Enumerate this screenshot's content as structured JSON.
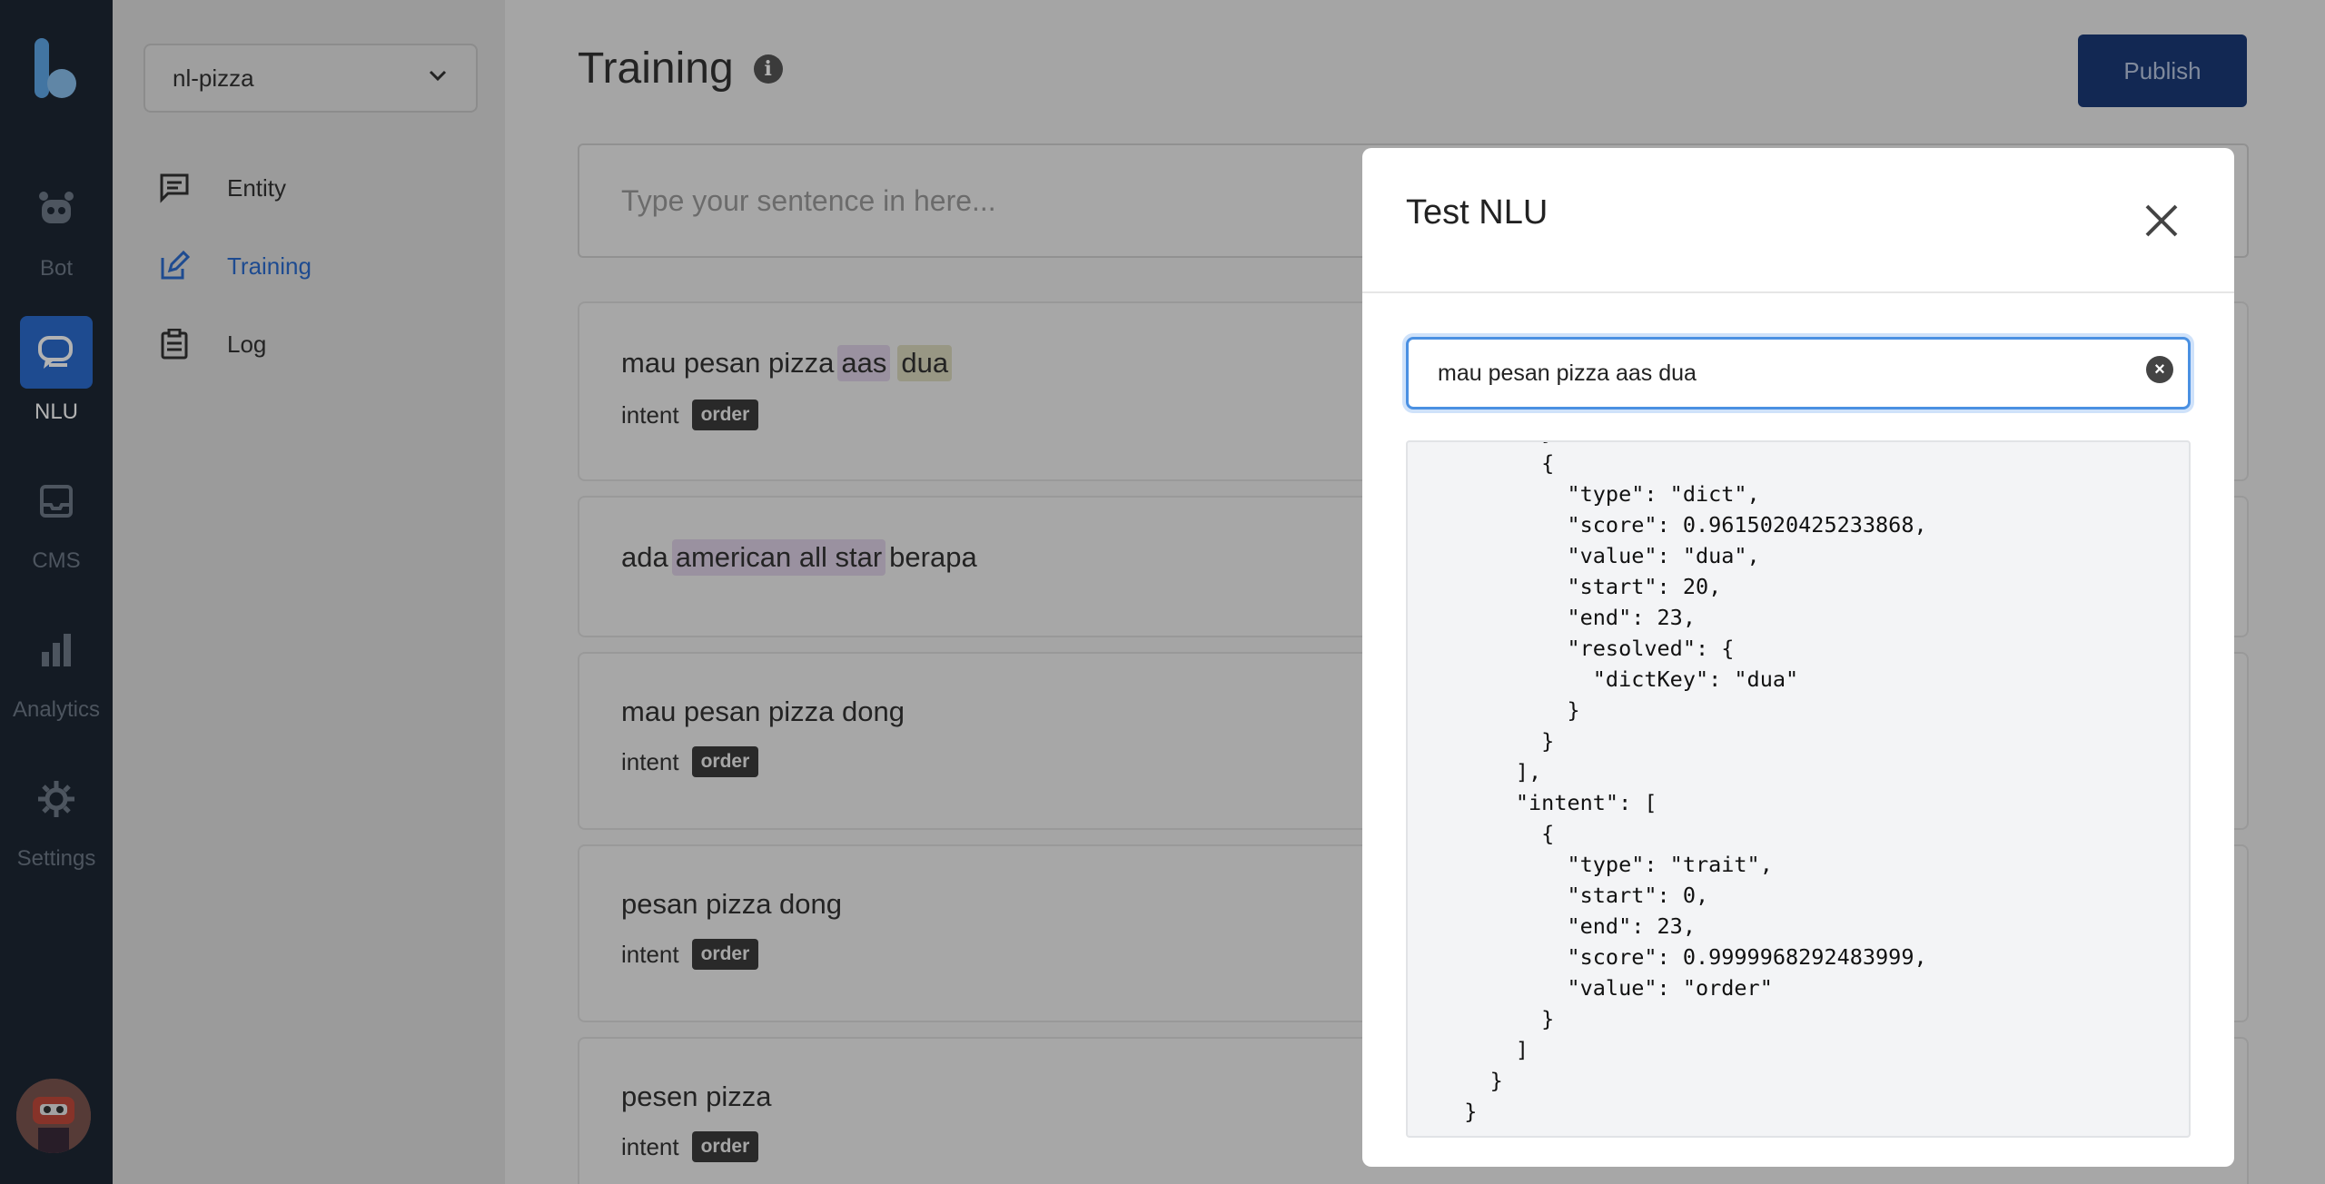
{
  "rail": {
    "items": [
      {
        "label": "Bot",
        "icon": "robot-icon"
      },
      {
        "label": "NLU",
        "icon": "chat-bubbles-icon",
        "active": true
      },
      {
        "label": "CMS",
        "icon": "inbox-icon"
      },
      {
        "label": "Analytics",
        "icon": "bar-chart-icon"
      },
      {
        "label": "Settings",
        "icon": "gear-icon"
      }
    ]
  },
  "sidebar": {
    "project": "nl-pizza",
    "items": [
      {
        "label": "Entity",
        "icon": "message-square-icon"
      },
      {
        "label": "Training",
        "icon": "edit-icon",
        "active": true
      },
      {
        "label": "Log",
        "icon": "clipboard-icon"
      }
    ]
  },
  "main": {
    "title": "Training",
    "publish_label": "Publish",
    "sentence_placeholder": "Type your sentence in here...",
    "cards": [
      {
        "parts": [
          "mau pesan pizza",
          "aas",
          "dua"
        ],
        "intent_label": "intent",
        "intent": "order"
      },
      {
        "parts": [
          "ada",
          "american all star",
          "berapa"
        ]
      },
      {
        "text": "mau pesan pizza dong",
        "intent_label": "intent",
        "intent": "order"
      },
      {
        "text": "pesan pizza dong",
        "intent_label": "intent",
        "intent": "order"
      },
      {
        "text": "pesen pizza",
        "intent_label": "intent",
        "intent": "order"
      }
    ]
  },
  "modal": {
    "title": "Test NLU",
    "input_value": "mau pesan pizza aas dua",
    "json_output": "        },\n        {\n          \"type\": \"dict\",\n          \"score\": 0.9615020425233868,\n          \"value\": \"dua\",\n          \"start\": 20,\n          \"end\": 23,\n          \"resolved\": {\n            \"dictKey\": \"dua\"\n          }\n        }\n      ],\n      \"intent\": [\n        {\n          \"type\": \"trait\",\n          \"start\": 0,\n          \"end\": 23,\n          \"score\": 0.9999968292483999,\n          \"value\": \"order\"\n        }\n      ]\n    }\n  }"
  },
  "colors": {
    "rail_bg": "#1d2734",
    "accent": "#2b6ccf",
    "publish_bg": "#1a3a78",
    "focus_border": "#4a90e2"
  }
}
